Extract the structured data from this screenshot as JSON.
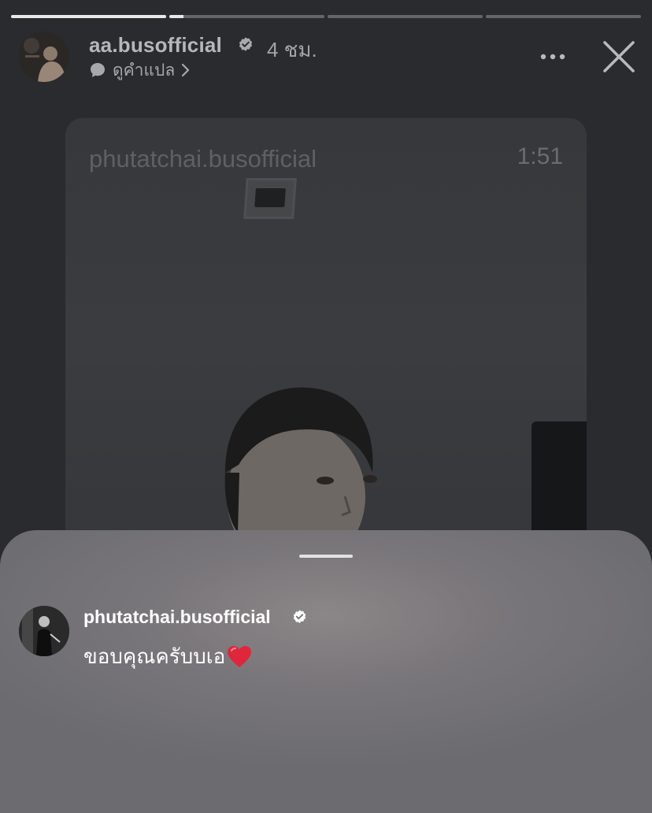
{
  "story": {
    "segments": [
      {
        "progress": 1.0
      },
      {
        "progress": 0.09
      },
      {
        "progress": 0.0
      },
      {
        "progress": 0.0
      }
    ]
  },
  "header": {
    "username": "aa.busofficial",
    "time": "4 ชม.",
    "translate_label": "ดูคำแปล",
    "icons": {
      "avatar": "profile-photo",
      "verified": "verified-badge-icon",
      "translate": "speech-bubble-icon",
      "chevron": "chevron-right-icon",
      "more": "more-icon",
      "close": "close-icon"
    }
  },
  "video": {
    "username": "phutatchai.busofficial",
    "duration": "1:51"
  },
  "reply": {
    "username": "phutatchai.busofficial",
    "message": "ขอบคุณครับบเอ",
    "emoji": "heart-icon"
  },
  "colors": {
    "background": "#2a2b2e",
    "sheet": "#79767a",
    "heart": "#e0263b"
  }
}
